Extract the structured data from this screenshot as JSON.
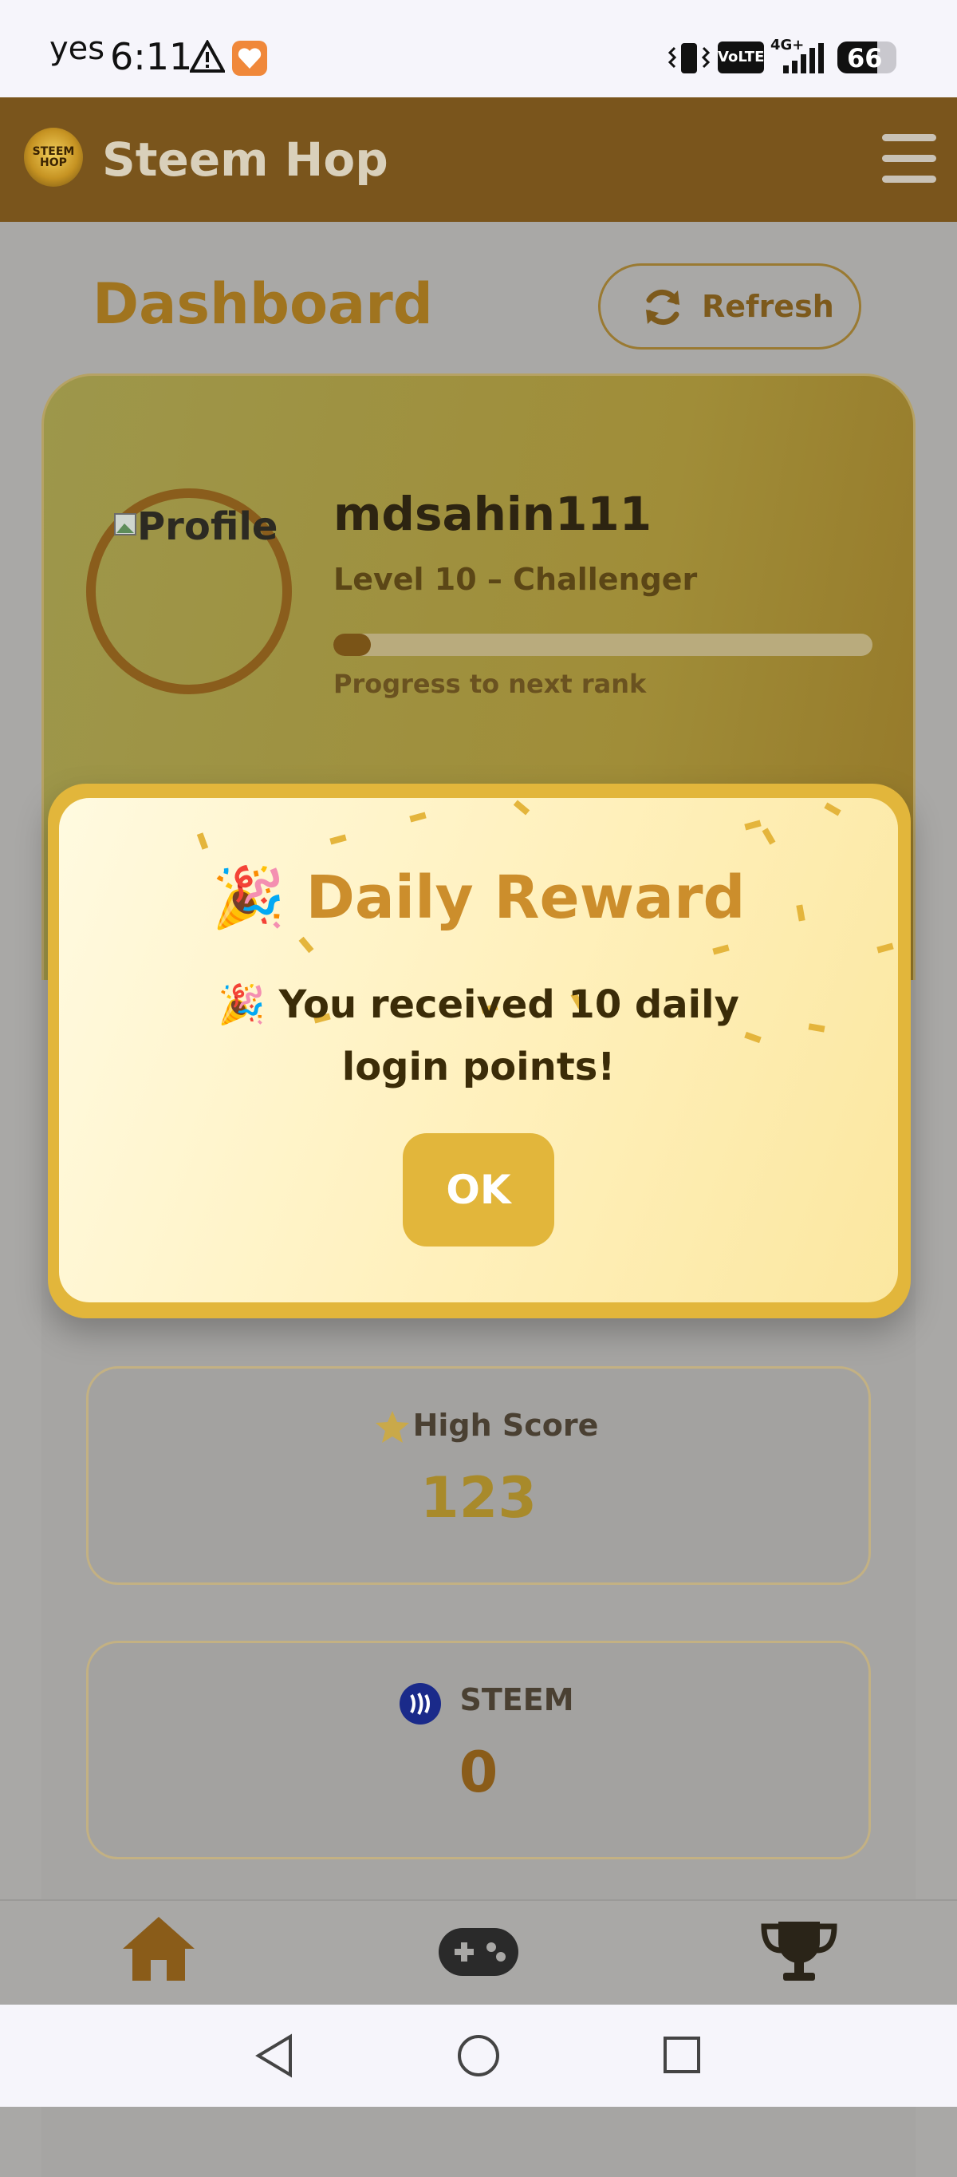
{
  "status_bar": {
    "carrier": "yes",
    "time": "6:11",
    "network": "4G+",
    "volte": "VoLTE",
    "battery": "66"
  },
  "app": {
    "title": "Steem Hop",
    "logo_text": "STEEM HOP"
  },
  "dashboard": {
    "title": "Dashboard",
    "refresh_label": "Refresh"
  },
  "profile": {
    "avatar_alt": "Profile",
    "username": "mdsahin111",
    "level": "Level 10 – Challenger",
    "progress_label": "Progress to next rank",
    "progress_fraction": 0.07
  },
  "stats": [
    {
      "label": "High Score",
      "value": "123",
      "icon": "star-icon",
      "value_color": "#a88a2b"
    },
    {
      "label": "STEEM",
      "value": "0",
      "icon": "steem-icon",
      "value_color": "#8a5c19"
    }
  ],
  "modal": {
    "title": "Daily Reward",
    "title_emoji": "🎉",
    "message_emoji": "🎉",
    "message": "You received 10 daily login points!",
    "ok_label": "OK"
  },
  "bottom_nav": [
    {
      "name": "home",
      "icon": "home-icon"
    },
    {
      "name": "games",
      "icon": "gamepad-icon"
    },
    {
      "name": "leaderboard",
      "icon": "trophy-icon"
    }
  ],
  "colors": {
    "header": "#7a551c",
    "accent": "#e2b63b",
    "brown": "#8a5c19"
  }
}
